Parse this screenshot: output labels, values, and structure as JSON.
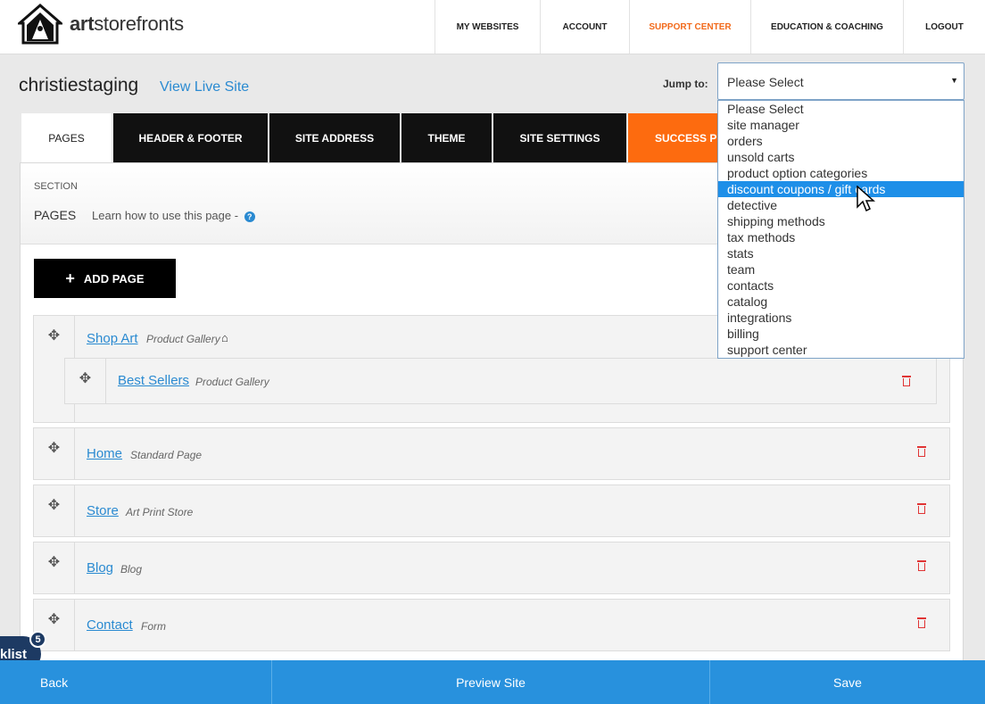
{
  "brand": {
    "name": "artstorefronts",
    "bold_part": "art",
    "rest_part": "storefronts"
  },
  "nav": {
    "items": [
      {
        "label": "MY WEBSITES"
      },
      {
        "label": "ACCOUNT"
      },
      {
        "label": "SUPPORT CENTER",
        "active": true
      },
      {
        "label": "EDUCATION & COACHING"
      },
      {
        "label": "LOGOUT"
      }
    ]
  },
  "site": {
    "name": "christiestaging",
    "live_link": "View Live Site"
  },
  "jump": {
    "label": "Jump to:",
    "selected": "Please Select",
    "options": [
      "Please Select",
      "site manager",
      "orders",
      "unsold carts",
      "product option categories",
      "discount coupons / gift cards",
      "detective",
      "shipping methods",
      "tax methods",
      "stats",
      "team",
      "contacts",
      "catalog",
      "integrations",
      "billing",
      "support center"
    ],
    "highlighted": "discount coupons / gift cards"
  },
  "tabs": [
    {
      "label": "PAGES",
      "current": true
    },
    {
      "label": "HEADER & FOOTER"
    },
    {
      "label": "SITE ADDRESS"
    },
    {
      "label": "THEME"
    },
    {
      "label": "SITE SETTINGS"
    },
    {
      "label": "SUCCESS P",
      "accent": true
    }
  ],
  "section": {
    "label": "SECTION",
    "title": "PAGES",
    "learn": "Learn how to use this page -",
    "help_icon": "?"
  },
  "add_page": {
    "label": "ADD PAGE",
    "icon": "+"
  },
  "pages": [
    {
      "name": "Shop Art",
      "type": "Product Gallery",
      "home": true
    },
    {
      "name": "Best Sellers",
      "type": "Product Gallery",
      "child": true
    },
    {
      "name": "Home",
      "type": "Standard Page"
    },
    {
      "name": "Store",
      "type": "Art Print Store"
    },
    {
      "name": "Blog",
      "type": "Blog"
    },
    {
      "name": "Contact",
      "type": "Form"
    }
  ],
  "footer": {
    "back": "Back",
    "preview": "Preview Site",
    "save": "Save"
  },
  "checklist": {
    "label": "klist",
    "count": "5"
  },
  "colors": {
    "accent": "#fd6b0f",
    "link": "#2a8ad1",
    "footer": "#2891dd",
    "highlight": "#1e8fe8"
  }
}
